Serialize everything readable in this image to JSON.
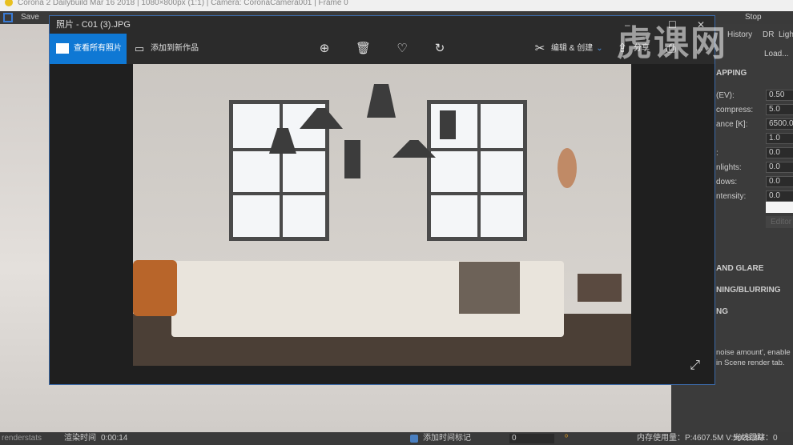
{
  "app": {
    "title": "Corona 2 Dailybuild Mar 16 2018 | 1080×800px (1:1) | Camera: CoronaCamera001 | Frame 0",
    "save_label": "Save"
  },
  "viewer": {
    "title": "照片 - C01 (3).JPG",
    "view_all": "查看所有照片",
    "add_to_creation": "添加到新作品",
    "edit_create": "编辑 & 创建",
    "share": "分享",
    "more": "…"
  },
  "right_panel": {
    "stop": "Stop",
    "tabs": [
      "History",
      "DR",
      "Ligh"
    ],
    "load": "Load...",
    "section_tonemapping": "APPING",
    "rows": [
      {
        "label": "(EV):",
        "value": "0.50"
      },
      {
        "label": "compress:",
        "value": "5.0"
      },
      {
        "label": "ance [K]:",
        "value": "6500.0"
      },
      {
        "label": "",
        "value": "1.0"
      },
      {
        "label": ":",
        "value": "0.0"
      },
      {
        "label": "nlights:",
        "value": "0.0"
      },
      {
        "label": "dows:",
        "value": "0.0"
      },
      {
        "label": "ntensity:",
        "value": "0.0"
      }
    ],
    "editor": "Editor",
    "sections": [
      "AND GLARE",
      "NING/BLURRING",
      "NG"
    ],
    "note": [
      "noise amount', enable",
      "in Scene render tab."
    ]
  },
  "status": {
    "left": "renderstats",
    "render_time_label": "渲染时间",
    "render_time": "0:00:14",
    "add_marker": "添加时间标记",
    "spinner": "0",
    "memory": "内存使用量：P:4607.5M V:5928.3M",
    "ray": "光线跟踪：0"
  },
  "watermark": "虎课网"
}
